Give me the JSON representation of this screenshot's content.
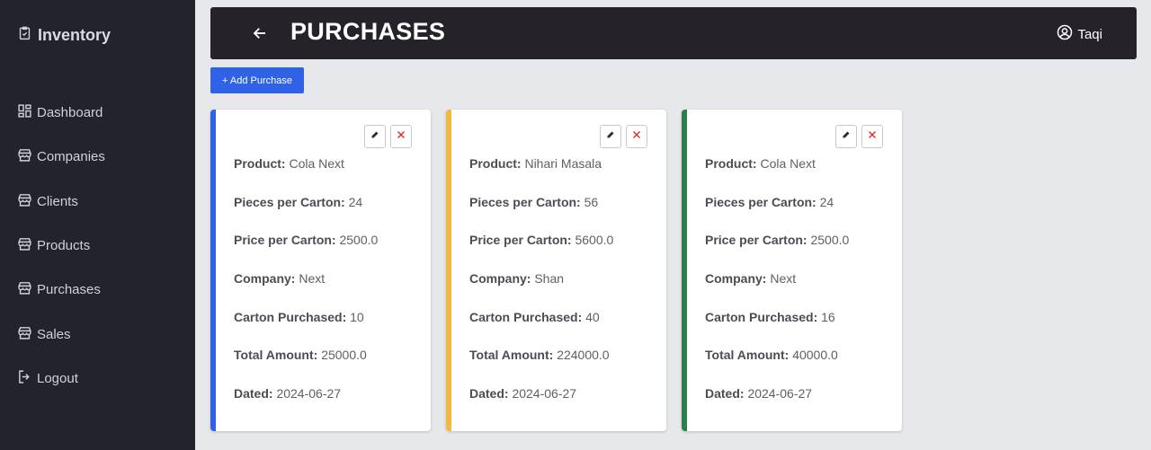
{
  "brand": {
    "name": "Inventory",
    "icon": "clipboard-check-icon"
  },
  "sidebar": {
    "items": [
      {
        "label": "Dashboard",
        "icon": "dashboard-icon"
      },
      {
        "label": "Companies",
        "icon": "store-icon"
      },
      {
        "label": "Clients",
        "icon": "store-icon"
      },
      {
        "label": "Products",
        "icon": "store-icon"
      },
      {
        "label": "Purchases",
        "icon": "store-icon"
      },
      {
        "label": "Sales",
        "icon": "store-icon"
      },
      {
        "label": "Logout",
        "icon": "logout-icon"
      }
    ]
  },
  "header": {
    "title": "PURCHASES",
    "user": "Taqi"
  },
  "actions": {
    "add_purchase": "+ Add Purchase"
  },
  "labels": {
    "product": "Product:",
    "pieces": "Pieces per Carton:",
    "price": "Price per Carton:",
    "company": "Company:",
    "cartons": "Carton Purchased:",
    "total": "Total Amount:",
    "dated": "Dated:"
  },
  "purchases": [
    {
      "accent": "#2f62e6",
      "product": "Cola Next",
      "pieces": "24",
      "price": "2500.0",
      "company": "Next",
      "cartons": "10",
      "total": "25000.0",
      "dated": "2024-06-27"
    },
    {
      "accent": "#f0b944",
      "product": "Nihari Masala",
      "pieces": "56",
      "price": "5600.0",
      "company": "Shan",
      "cartons": "40",
      "total": "224000.0",
      "dated": "2024-06-27"
    },
    {
      "accent": "#2e7d4f",
      "product": "Cola Next",
      "pieces": "24",
      "price": "2500.0",
      "company": "Next",
      "cartons": "16",
      "total": "40000.0",
      "dated": "2024-06-27"
    }
  ]
}
